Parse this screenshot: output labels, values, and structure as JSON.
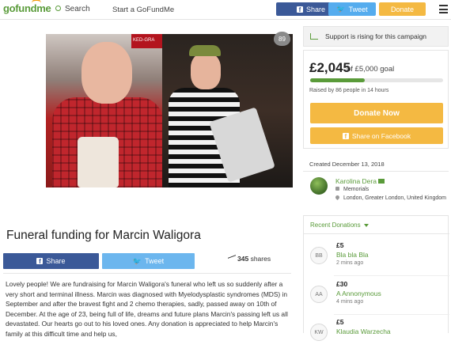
{
  "header": {
    "logo": "gofundme",
    "search_label": "Search",
    "start_label": "Start a GoFundMe",
    "share_label": "Share",
    "tweet_label": "Tweet",
    "donate_label": "Donate"
  },
  "photo": {
    "like_count": "89",
    "sign_text": "KED-GRA"
  },
  "campaign": {
    "title": "Funeral funding for Marcin Waligora",
    "share_label": "Share",
    "tweet_label": "Tweet",
    "shares_count": "345",
    "shares_label": "shares",
    "story": "Lovely people! We are fundraising for Marcin Waligora's funeral who left us so suddenly after a very short and terminal illness. Marcin was diagnosed with Myelodysplastic syndromes (MDS) in September and after the bravest fight and 2 chemo therapies, sadly, passed away on 10th of December. At the age of 23, being full of life, dreams and future plans Marcin's passing left us all devastated. Our hearts go out to his loved ones. Any donation is appreciated to help Marcin's family at this difficult time and help us,"
  },
  "sidebar": {
    "rising_text": "Support is rising for this campaign",
    "amount": "£2,045",
    "goal_text": "of £5,000 goal",
    "progress": 0.41,
    "raised_text": "Raised by 86 people in 14 hours",
    "donate_now_label": "Donate Now",
    "share_facebook_label": "Share on Facebook",
    "created": "Created December 13, 2018",
    "organizer_name": "Karolina Dera",
    "organizer_category": "Memorials",
    "organizer_location": "London, Greater London, United Kingdom",
    "recent_title": "Recent Donations",
    "donations": [
      {
        "initials": "BB",
        "amount": "£5",
        "name": "Bla bla Bla",
        "time": "2 mins ago"
      },
      {
        "initials": "AA",
        "amount": "£30",
        "name": "A Annonymous",
        "time": "4 mins ago"
      },
      {
        "initials": "KW",
        "amount": "£5",
        "name": "Klaudia Warzecha",
        "time": ""
      }
    ]
  },
  "colors": {
    "brand_green": "#5a9b3a",
    "facebook_blue": "#3b5998",
    "twitter_blue": "#55acee",
    "donate_yellow": "#f4b942"
  }
}
